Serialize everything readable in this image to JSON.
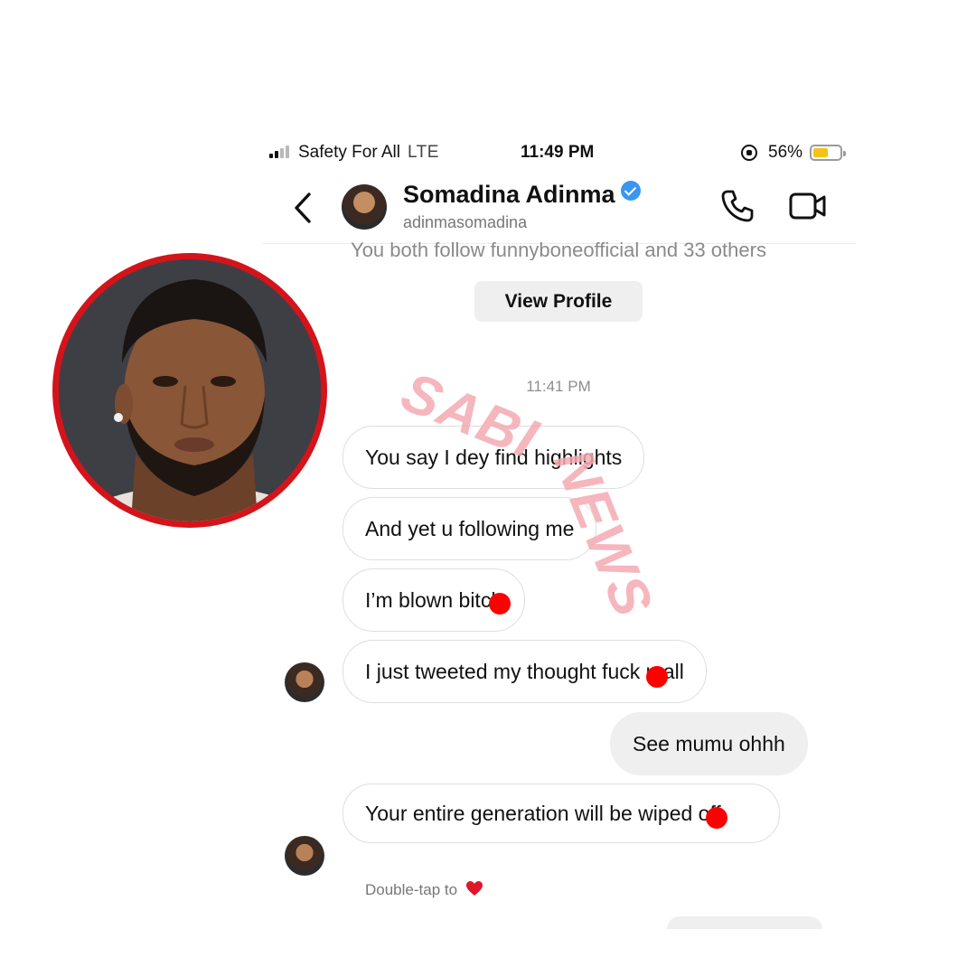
{
  "status_bar": {
    "carrier": "Safety For All",
    "network": "LTE",
    "time": "11:49 PM",
    "battery_percent": "56%",
    "battery_level": 0.56
  },
  "header": {
    "back_icon": "chevron-left-icon",
    "name": "Somadina Adinma",
    "verified": true,
    "handle": "adinmasomadina",
    "call_icon": "phone-icon",
    "video_icon": "video-camera-icon"
  },
  "conversation": {
    "mutual_followers": "You both follow funnyboneofficial and 33 others",
    "view_profile_label": "View Profile",
    "timestamp": "11:41 PM",
    "messages": [
      {
        "side": "in",
        "text": "You say I dey find highlights"
      },
      {
        "side": "in",
        "text": "And yet u following me"
      },
      {
        "side": "in",
        "text": "I’m blown bitch"
      },
      {
        "side": "in",
        "text": "I just tweeted my thought fuck u all"
      },
      {
        "side": "out",
        "text": "See mumu  ohhh"
      },
      {
        "side": "in",
        "text": "Your entire generation will be wiped off"
      }
    ],
    "reaction_hint": "Double-tap to",
    "reaction_icon": "red-heart-icon"
  },
  "overlay": {
    "watermark": "SABINEWS",
    "watermark_color": "#f4a9b2",
    "photo_ring_color": "#d4141a",
    "censor_dot_color": "#ff0000"
  }
}
